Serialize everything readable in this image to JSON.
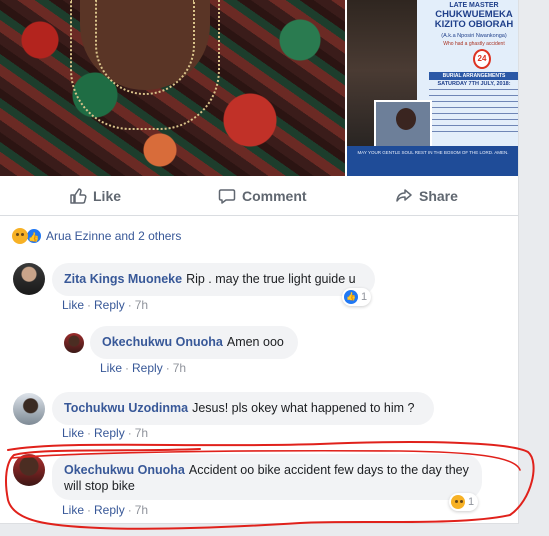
{
  "poster": {
    "title_small": "LATE MASTER",
    "title_name": "CHUKWUEMEKA KIZITO OBIORAH",
    "aka": "(A.k.a Nposiri Nwankonga)",
    "accident": "Who had a ghastly accident",
    "date_badge": "24",
    "banner": "BURIAL ARRANGEMENTS",
    "saturday": "SATURDAY 7TH JULY, 2018:",
    "footer": "MAY YOUR GENTLE SOUL REST IN THE BOSOM OF THE LORD. AMEN."
  },
  "actions": {
    "like": "Like",
    "comment": "Comment",
    "share": "Share"
  },
  "reactions_summary": "Arua Ezinne and 2 others",
  "comments": [
    {
      "name": "Zita Kings Muoneke",
      "text": "Rip . may the true light guide u",
      "like_label": "Like",
      "reply_label": "Reply",
      "time": "7h",
      "reaction_count": "1"
    },
    {
      "name": "Okechukwu Onuoha",
      "text": "Amen ooo",
      "like_label": "Like",
      "reply_label": "Reply",
      "time": "7h"
    },
    {
      "name": "Tochukwu Uzodinma",
      "text": "Jesus! pls okey what happened to him ?",
      "like_label": "Like",
      "reply_label": "Reply",
      "time": "7h"
    },
    {
      "name": "Okechukwu Onuoha",
      "text": "Accident oo bike accident few days to the day they will stop bike",
      "like_label": "Like",
      "reply_label": "Reply",
      "time": "7h",
      "reaction_count": "1"
    }
  ],
  "colors": {
    "link": "#385898",
    "bubble": "#f2f3f5",
    "annotation": "#e0211b"
  }
}
